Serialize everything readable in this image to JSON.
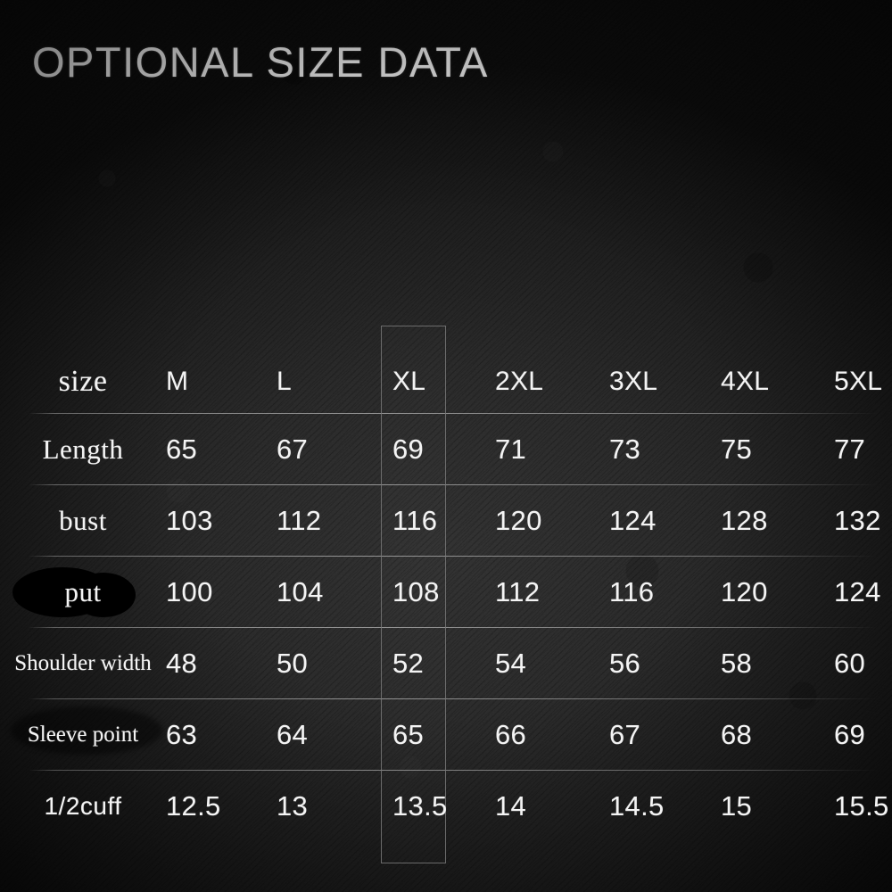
{
  "title": "OPTIONAL SIZE DATA",
  "colors": {
    "background": "#1e1e1e",
    "text": "#f4f4f4",
    "rule": "#b0b0b0",
    "highlight_border": "#787878",
    "redaction": "#000000"
  },
  "highlight": {
    "column": "XL",
    "name": "xl-column-highlight"
  },
  "table": {
    "corner_label": "size",
    "columns": [
      "M",
      "L",
      "XL",
      "2XL",
      "3XL",
      "4XL",
      "5XL"
    ],
    "rows": [
      {
        "label": "Length",
        "style": "serif",
        "redaction": "none",
        "values": [
          "65",
          "67",
          "69",
          "71",
          "73",
          "75",
          "77"
        ]
      },
      {
        "label": "bust",
        "style": "serif",
        "redaction": "none",
        "values": [
          "103",
          "112",
          "116",
          "120",
          "124",
          "128",
          "132"
        ]
      },
      {
        "label": "put",
        "style": "serif",
        "redaction": "dark",
        "values": [
          "100",
          "104",
          "108",
          "112",
          "116",
          "120",
          "124"
        ]
      },
      {
        "label": "Shoulder width",
        "style": "small",
        "redaction": "none",
        "values": [
          "48",
          "50",
          "52",
          "54",
          "56",
          "58",
          "60"
        ]
      },
      {
        "label": "Sleeve point",
        "style": "small",
        "redaction": "faint",
        "values": [
          "63",
          "64",
          "65",
          "66",
          "67",
          "68",
          "69"
        ]
      },
      {
        "label": "1/2cuff",
        "style": "sans",
        "redaction": "none",
        "values": [
          "12.5",
          "13",
          "13.5",
          "14",
          "14.5",
          "15",
          "15.5"
        ]
      }
    ]
  },
  "chart_data": {
    "type": "table",
    "title": "OPTIONAL SIZE DATA",
    "categories": [
      "M",
      "L",
      "XL",
      "2XL",
      "3XL",
      "4XL",
      "5XL"
    ],
    "series": [
      {
        "name": "Length",
        "values": [
          65,
          67,
          69,
          71,
          73,
          75,
          77
        ]
      },
      {
        "name": "bust",
        "values": [
          103,
          112,
          116,
          120,
          124,
          128,
          132
        ]
      },
      {
        "name": "put",
        "values": [
          100,
          104,
          108,
          112,
          116,
          120,
          124
        ]
      },
      {
        "name": "Shoulder width",
        "values": [
          48,
          50,
          52,
          54,
          56,
          58,
          60
        ]
      },
      {
        "name": "Sleeve point",
        "values": [
          63,
          64,
          65,
          66,
          67,
          68,
          69
        ]
      },
      {
        "name": "1/2cuff",
        "values": [
          12.5,
          13,
          13.5,
          14,
          14.5,
          15,
          15.5
        ]
      }
    ],
    "xlabel": "size",
    "ylabel": "",
    "grid": true,
    "legend": "none",
    "highlighted_category": "XL"
  }
}
